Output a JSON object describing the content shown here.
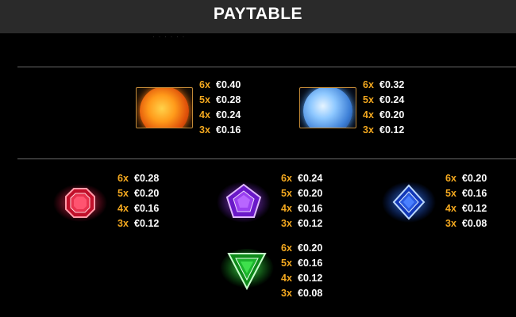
{
  "header": {
    "title": "PAYTABLE"
  },
  "faint_text": "· · · · · ·",
  "symbols": {
    "sun": {
      "name": "sun",
      "pays": [
        {
          "mult": "6x",
          "amount": "€0.40"
        },
        {
          "mult": "5x",
          "amount": "€0.28"
        },
        {
          "mult": "4x",
          "amount": "€0.24"
        },
        {
          "mult": "3x",
          "amount": "€0.16"
        }
      ]
    },
    "moon": {
      "name": "moon",
      "pays": [
        {
          "mult": "6x",
          "amount": "€0.32"
        },
        {
          "mult": "5x",
          "amount": "€0.24"
        },
        {
          "mult": "4x",
          "amount": "€0.20"
        },
        {
          "mult": "3x",
          "amount": "€0.12"
        }
      ]
    },
    "red": {
      "name": "red gem",
      "pays": [
        {
          "mult": "6x",
          "amount": "€0.28"
        },
        {
          "mult": "5x",
          "amount": "€0.20"
        },
        {
          "mult": "4x",
          "amount": "€0.16"
        },
        {
          "mult": "3x",
          "amount": "€0.12"
        }
      ]
    },
    "purple": {
      "name": "purple gem",
      "pays": [
        {
          "mult": "6x",
          "amount": "€0.24"
        },
        {
          "mult": "5x",
          "amount": "€0.20"
        },
        {
          "mult": "4x",
          "amount": "€0.16"
        },
        {
          "mult": "3x",
          "amount": "€0.12"
        }
      ]
    },
    "blue": {
      "name": "blue gem",
      "pays": [
        {
          "mult": "6x",
          "amount": "€0.20"
        },
        {
          "mult": "5x",
          "amount": "€0.16"
        },
        {
          "mult": "4x",
          "amount": "€0.12"
        },
        {
          "mult": "3x",
          "amount": "€0.08"
        }
      ]
    },
    "green": {
      "name": "green gem",
      "pays": [
        {
          "mult": "6x",
          "amount": "€0.20"
        },
        {
          "mult": "5x",
          "amount": "€0.16"
        },
        {
          "mult": "4x",
          "amount": "€0.12"
        },
        {
          "mult": "3x",
          "amount": "€0.08"
        }
      ]
    }
  },
  "colors": {
    "multiplier": "#f3a81f",
    "header_bg": "#2a2a2a",
    "divider": "#6a6a6a",
    "frame": "#c28a38"
  },
  "icons": [
    "sun-icon",
    "moon-icon",
    "red-octagon-gem-icon",
    "purple-pentagon-gem-icon",
    "blue-diamond-gem-icon",
    "green-triangle-gem-icon"
  ]
}
